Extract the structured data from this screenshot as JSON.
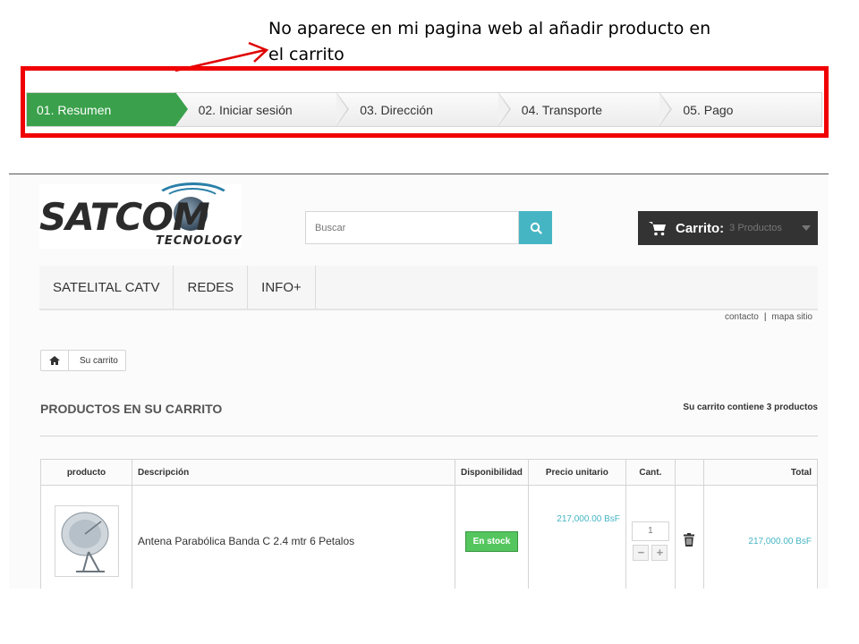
{
  "annotation": {
    "line1": "No aparece en mi pagina web al añadir producto  en",
    "line2": "el carrito"
  },
  "steps": [
    {
      "label": "01. Resumen",
      "current": true
    },
    {
      "label": "02. Iniciar sesión",
      "current": false
    },
    {
      "label": "03. Dirección",
      "current": false
    },
    {
      "label": "04. Transporte",
      "current": false
    },
    {
      "label": "05. Pago",
      "current": false
    }
  ],
  "header": {
    "logo_text": "SATCOM",
    "logo_sub": "TECNOLOGY",
    "search_placeholder": "Buscar",
    "search_icon": "search-icon",
    "cart_label": "Carrito:",
    "cart_count": "3 Productos",
    "cart_icon": "shopping-cart-icon"
  },
  "menu": [
    "SATELITAL CATV",
    "REDES",
    "INFO+"
  ],
  "top_links": {
    "contact": "contacto",
    "sitemap": "mapa sitio"
  },
  "breadcrumb": {
    "home_icon": "home-icon",
    "current": "Su carrito"
  },
  "page": {
    "heading": "PRODUCTOS EN SU CARRITO",
    "summary": "Su carrito contiene 3 productos"
  },
  "table": {
    "headers": {
      "product": "producto",
      "description": "Descripción",
      "availability": "Disponibilidad",
      "unit_price": "Precio unitario",
      "qty": "Cant.",
      "total": "Total"
    },
    "rows": [
      {
        "description": "Antena Parabólica Banda C 2.4 mtr 6 Petalos",
        "availability": "En stock",
        "unit_price": "217,000.00 BsF",
        "qty": "1",
        "minus": "−",
        "plus": "+",
        "total": "217,000.00 BsF"
      }
    ]
  },
  "colors": {
    "annotation_red": "#f00000",
    "step_active": "#3aa04b",
    "accent_teal": "#46b5c3",
    "cart_dark": "#333333",
    "stock_green": "#55c65e"
  }
}
